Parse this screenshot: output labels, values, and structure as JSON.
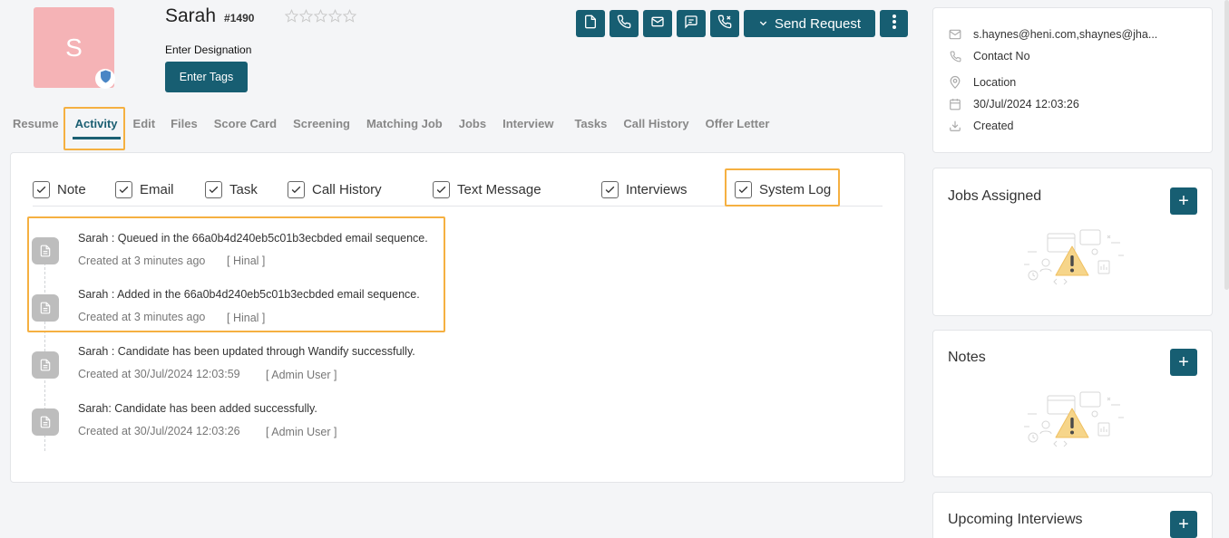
{
  "candidate": {
    "initial": "S",
    "name": "Sarah",
    "id": "#1490",
    "rating": 0,
    "designation": "Enter Designation",
    "tags_button": "Enter Tags"
  },
  "actions": {
    "send_request": "Send Request",
    "icons": [
      "document-icon",
      "phone-icon",
      "mail-icon",
      "message-icon",
      "call-log-icon"
    ]
  },
  "tabs": [
    {
      "label": "Resume"
    },
    {
      "label": "Activity",
      "active": true
    },
    {
      "label": "Edit"
    },
    {
      "label": "Files"
    },
    {
      "label": "Score Card"
    },
    {
      "label": "Screening"
    },
    {
      "label": "Matching Job"
    },
    {
      "label": "Jobs"
    },
    {
      "label": "Interview"
    },
    {
      "label": "Tasks"
    },
    {
      "label": "Call History"
    },
    {
      "label": "Offer Letter"
    }
  ],
  "filters": [
    {
      "label": "Note",
      "checked": true
    },
    {
      "label": "Email",
      "checked": true
    },
    {
      "label": "Task",
      "checked": true
    },
    {
      "label": "Call History",
      "checked": true
    },
    {
      "label": "Text Message",
      "checked": true
    },
    {
      "label": "Interviews",
      "checked": true
    },
    {
      "label": "System Log",
      "checked": true
    }
  ],
  "logs": [
    {
      "text": "Sarah : Queued in the 66a0b4d240eb5c01b3ecbded email sequence.",
      "created": "Created at 3 minutes ago",
      "user": "[ Hinal ]"
    },
    {
      "text": "Sarah : Added in the 66a0b4d240eb5c01b3ecbded email sequence.",
      "created": "Created at 3 minutes ago",
      "user": "[ Hinal ]"
    },
    {
      "text": "Sarah : Candidate has been updated through Wandify successfully.",
      "created": "Created at 30/Jul/2024 12:03:59",
      "user": "[ Admin User ]"
    },
    {
      "text": "Sarah: Candidate has been added successfully.",
      "created": "Created at 30/Jul/2024 12:03:26",
      "user": "[ Admin User ]"
    }
  ],
  "info": {
    "email": "s.haynes@heni.com,shaynes@jha...",
    "contact": "Contact No",
    "location": "Location",
    "date": "30/Jul/2024 12:03:26",
    "created": "Created"
  },
  "cards": {
    "jobs_assigned": "Jobs Assigned",
    "notes": "Notes",
    "upcoming_interviews": "Upcoming Interviews",
    "plus_label": "+"
  },
  "colors": {
    "primary": "#175e72",
    "highlight": "#f5b041",
    "avatar_bg": "#f5b3b6"
  }
}
